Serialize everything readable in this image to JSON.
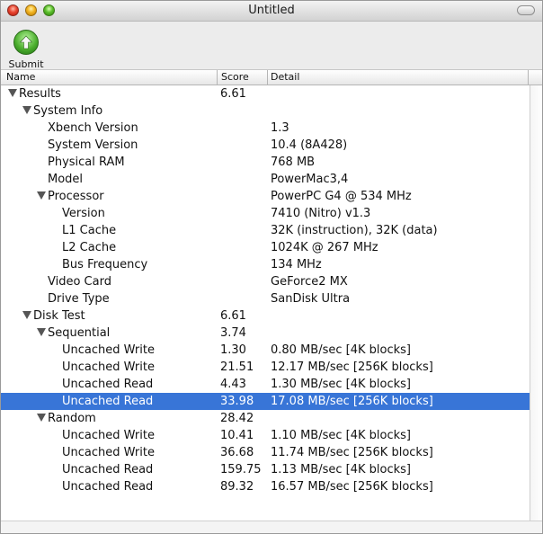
{
  "window": {
    "title": "Untitled"
  },
  "toolbar": {
    "submit_label": "Submit"
  },
  "columns": {
    "name": "Name",
    "score": "Score",
    "detail": "Detail"
  },
  "rows": [
    {
      "name": "Results",
      "score": "6.61",
      "detail": "",
      "level": 0,
      "expanded": true
    },
    {
      "name": "System Info",
      "score": "",
      "detail": "",
      "level": 1,
      "expanded": true
    },
    {
      "name": "Xbench Version",
      "score": "",
      "detail": "1.3",
      "level": 2
    },
    {
      "name": "System Version",
      "score": "",
      "detail": "10.4 (8A428)",
      "level": 2
    },
    {
      "name": "Physical RAM",
      "score": "",
      "detail": "768 MB",
      "level": 2
    },
    {
      "name": "Model",
      "score": "",
      "detail": "PowerMac3,4",
      "level": 2
    },
    {
      "name": "Processor",
      "score": "",
      "detail": "PowerPC G4 @ 534 MHz",
      "level": 2,
      "expanded": true
    },
    {
      "name": "Version",
      "score": "",
      "detail": "7410 (Nitro) v1.3",
      "level": 3
    },
    {
      "name": "L1 Cache",
      "score": "",
      "detail": "32K (instruction), 32K (data)",
      "level": 3
    },
    {
      "name": "L2 Cache",
      "score": "",
      "detail": "1024K @ 267 MHz",
      "level": 3
    },
    {
      "name": "Bus Frequency",
      "score": "",
      "detail": "134 MHz",
      "level": 3
    },
    {
      "name": "Video Card",
      "score": "",
      "detail": "GeForce2 MX",
      "level": 2
    },
    {
      "name": "Drive Type",
      "score": "",
      "detail": "SanDisk Ultra",
      "level": 2
    },
    {
      "name": "Disk Test",
      "score": "6.61",
      "detail": "",
      "level": 1,
      "expanded": true
    },
    {
      "name": "Sequential",
      "score": "3.74",
      "detail": "",
      "level": 2,
      "expanded": true
    },
    {
      "name": "Uncached Write",
      "score": "1.30",
      "detail": "0.80 MB/sec [4K blocks]",
      "level": 3
    },
    {
      "name": "Uncached Write",
      "score": "21.51",
      "detail": "12.17 MB/sec [256K blocks]",
      "level": 3
    },
    {
      "name": "Uncached Read",
      "score": "4.43",
      "detail": "1.30 MB/sec [4K blocks]",
      "level": 3
    },
    {
      "name": "Uncached Read",
      "score": "33.98",
      "detail": "17.08 MB/sec [256K blocks]",
      "level": 3,
      "selected": true
    },
    {
      "name": "Random",
      "score": "28.42",
      "detail": "",
      "level": 2,
      "expanded": true
    },
    {
      "name": "Uncached Write",
      "score": "10.41",
      "detail": "1.10 MB/sec [4K blocks]",
      "level": 3
    },
    {
      "name": "Uncached Write",
      "score": "36.68",
      "detail": "11.74 MB/sec [256K blocks]",
      "level": 3
    },
    {
      "name": "Uncached Read",
      "score": "159.75",
      "detail": "1.13 MB/sec [4K blocks]",
      "level": 3
    },
    {
      "name": "Uncached Read",
      "score": "89.32",
      "detail": "16.57 MB/sec [256K blocks]",
      "level": 3
    }
  ],
  "colors": {
    "selection": "#3875d7",
    "disclosure": "#555555"
  },
  "icons": {
    "submit": "green-up-arrow-icon",
    "disclosure": "disclosure-triangle-icon"
  }
}
